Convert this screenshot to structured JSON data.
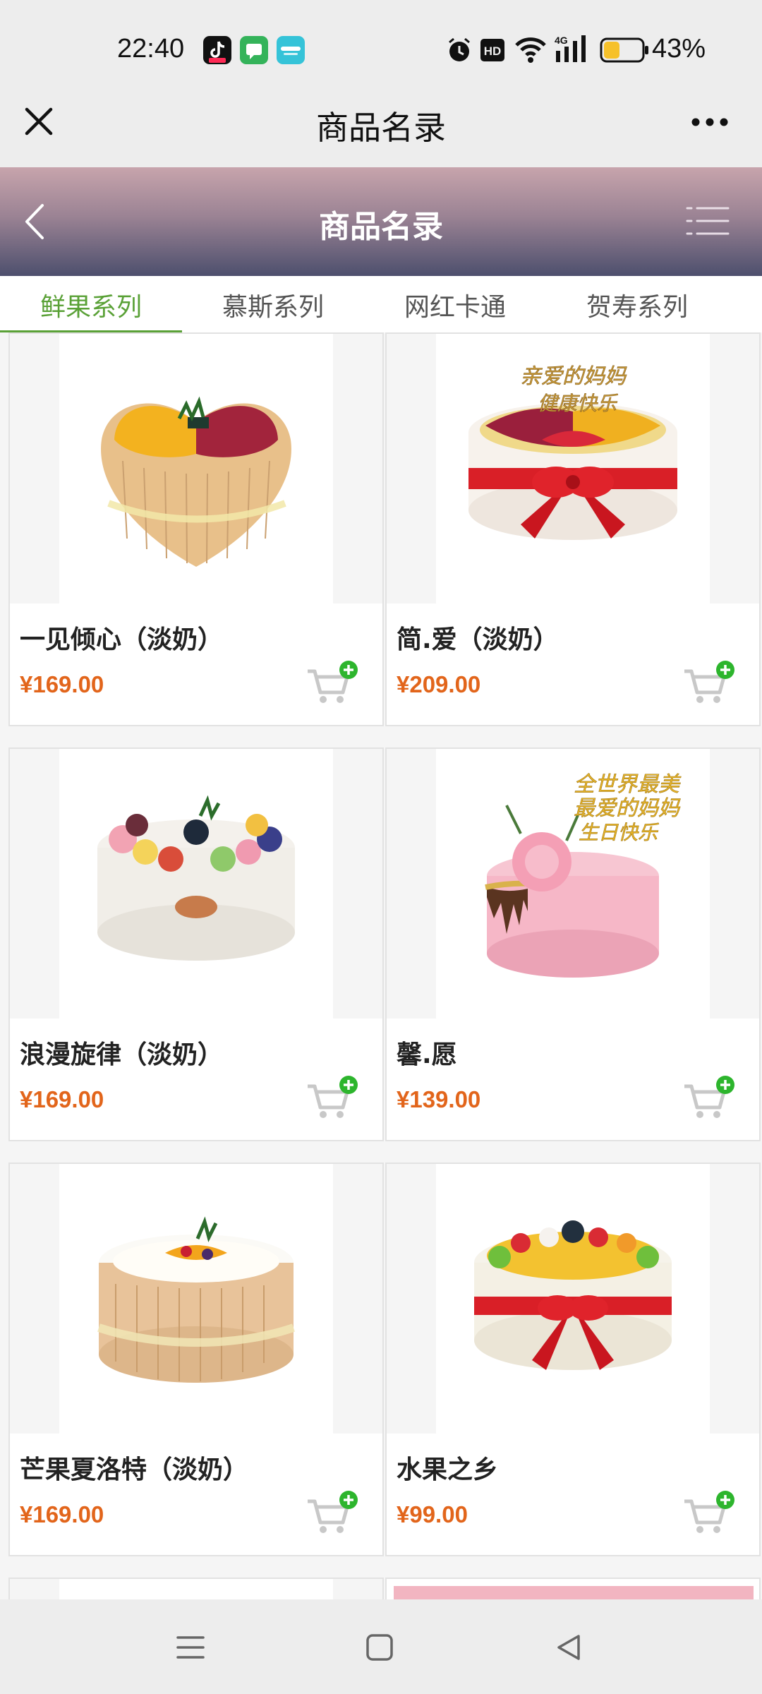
{
  "status": {
    "time": "22:40",
    "battery": "43%",
    "battery_level": 0.43,
    "icons": [
      "tiktok-app-icon",
      "chat-app-icon",
      "weather-app-icon",
      "alarm-icon",
      "hd-icon",
      "wifi-icon",
      "signal-4g-icon",
      "battery-icon"
    ]
  },
  "titlebar": {
    "title": "商品名录",
    "close_icon": "close-icon",
    "more_icon": "more-icon"
  },
  "header": {
    "title": "商品名录",
    "back_icon": "back-icon",
    "menu_icon": "list-menu-icon"
  },
  "tabs": [
    {
      "label": "鲜果系列",
      "active": true
    },
    {
      "label": "慕斯系列",
      "active": false
    },
    {
      "label": "网红卡通",
      "active": false
    },
    {
      "label": "贺寿系列",
      "active": false
    }
  ],
  "products": [
    {
      "name": "一见倾心（淡奶）",
      "price": "¥169.00",
      "image": "heart-fruit-cake"
    },
    {
      "name": "简.爱（淡奶）",
      "price": "¥209.00",
      "image": "ribbon-fruit-cake-topper"
    },
    {
      "name": "浪漫旋律（淡奶）",
      "price": "¥169.00",
      "image": "macaron-white-cake"
    },
    {
      "name": "馨.愿",
      "price": "¥139.00",
      "image": "pink-flower-cake"
    },
    {
      "name": "芒果夏洛特（淡奶）",
      "price": "¥169.00",
      "image": "ladyfinger-mango-cake"
    },
    {
      "name": "水果之乡",
      "price": "¥99.00",
      "image": "ribbon-fruit-cake"
    }
  ],
  "image_text": {
    "topper_1": "亲爱的妈妈",
    "topper_2": "健康快乐",
    "topper_3": "全世界最美",
    "topper_4": "最爱的妈妈",
    "topper_5": "生日快乐"
  },
  "colors": {
    "accent": "#5aa137",
    "price": "#e2651b",
    "cart_plus": "#2db52d"
  },
  "navbar": {
    "icons": [
      "menu-icon",
      "home-icon",
      "back-nav-icon"
    ]
  }
}
